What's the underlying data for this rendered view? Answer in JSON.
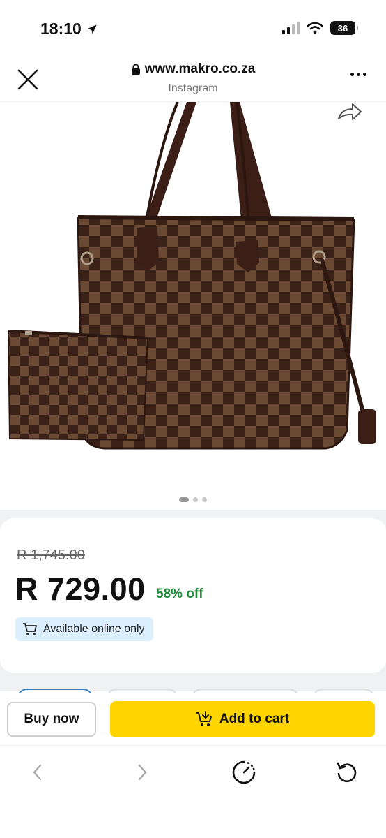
{
  "status_bar": {
    "time": "18:10",
    "battery": "36"
  },
  "browser": {
    "url": "www.makro.co.za",
    "source": "Instagram"
  },
  "product": {
    "image_alt": "Checkered brown tote bag with pouch",
    "carousel": {
      "total": 3,
      "active_index": 0
    }
  },
  "pricing": {
    "old_price": "R 1,745.00",
    "price": "R 729.00",
    "discount": "58% off",
    "availability": "Available online only"
  },
  "actions": {
    "buy_now": "Buy now",
    "add_to_cart": "Add to cart"
  },
  "colors": {
    "cart_button": "#ffd500",
    "discount_text": "#1f8a3a",
    "availability_bg": "#dcefff",
    "bag_dark": "#3a2218",
    "bag_light": "#6b4a33"
  }
}
